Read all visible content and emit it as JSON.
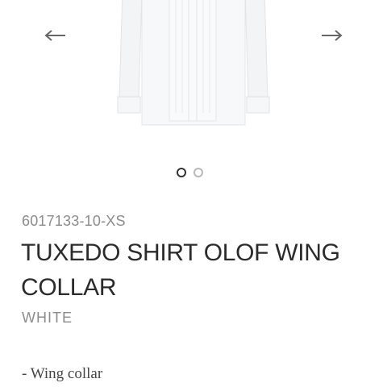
{
  "gallery": {
    "image_icon": "tuxedo-shirt",
    "prev_icon": "arrow-left",
    "next_icon": "arrow-right",
    "slides": 2,
    "active_slide": 1
  },
  "product": {
    "sku": "6017133-10-XS",
    "title": "TUXEDO SHIRT OLOF WING COLLAR",
    "color": "WHITE",
    "description_item": "- Wing collar"
  },
  "colors": {
    "text_dark": "#2b2b2b",
    "text_muted": "#8c8c8c",
    "dot_active": "#333333",
    "dot_inactive": "#b9b9b9"
  }
}
